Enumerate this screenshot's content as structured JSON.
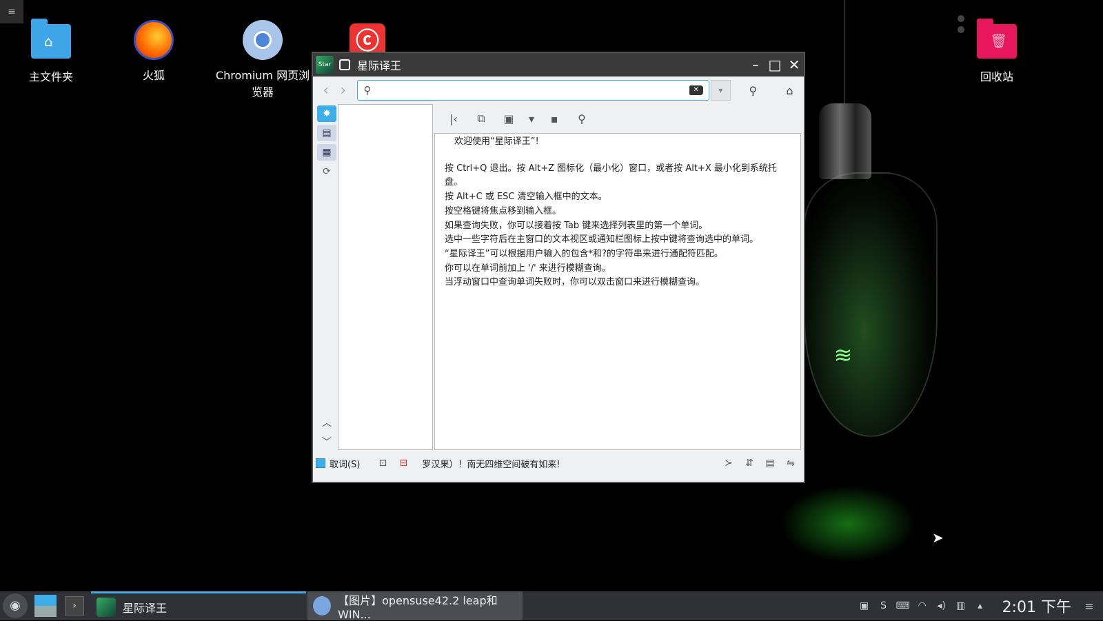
{
  "desktop": {
    "menu_glyph": "≡",
    "icons": [
      {
        "label": "主文件夹"
      },
      {
        "label": "火狐"
      },
      {
        "label": "Chromium 网页浏览器"
      },
      {
        "label": ""
      },
      {
        "label": "回收站"
      }
    ]
  },
  "window": {
    "title": "星际译王",
    "search": {
      "value": "",
      "placeholder": ""
    },
    "controls": {
      "minimize": "–",
      "maximize": "□",
      "close": "✕"
    },
    "welcome": "欢迎使用“星际译王”!",
    "tips": [
      "按 Ctrl+Q 退出。按 Alt+Z 图标化（最小化）窗口，或者按 Alt+X 最小化到系统托盘。",
      "按 Alt+C 或 ESC 清空输入框中的文本。",
      "按空格键将焦点移到输入框。",
      "如果查询失败，你可以接着按 Tab 键来选择列表里的第一个单词。",
      "选中一些字符后在主窗口的文本视区或通知栏图标上按中键将查询选中的单词。",
      "“星际译王”可以根据用户输入的包含*和?的字符串来进行通配符匹配。",
      "你可以在单词前加上 '/' 来进行模糊查询。",
      "当浮动窗口中查询单词失败时，你可以双击窗口来进行模糊查询。"
    ],
    "status": {
      "scan_label": "取词(S)",
      "message": "罗汉果）！南无四维空间破有如来!"
    }
  },
  "taskbar": {
    "tasks": [
      {
        "label": "星际译王"
      },
      {
        "label": "【图片】opensuse42.2 leap和WIN..."
      }
    ],
    "clock": "2:01 下午"
  }
}
